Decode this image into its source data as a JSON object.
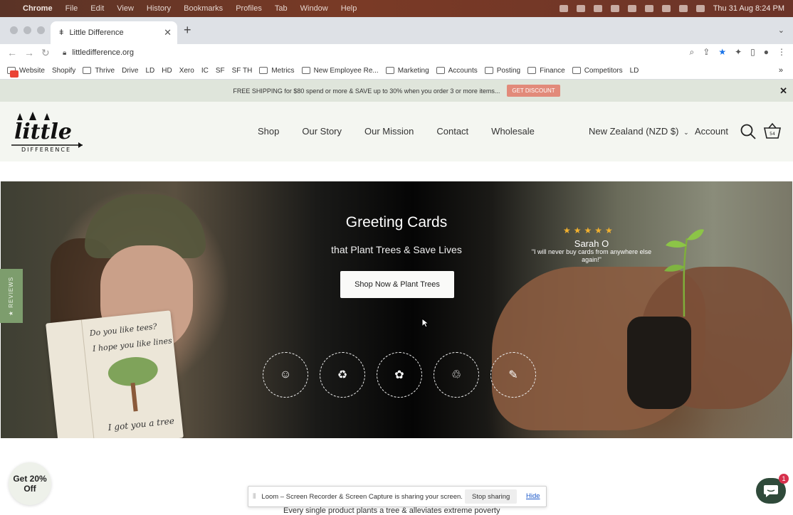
{
  "menubar": {
    "app": "Chrome",
    "items": [
      "File",
      "Edit",
      "View",
      "History",
      "Bookmarks",
      "Profiles",
      "Tab",
      "Window",
      "Help"
    ],
    "clock": "Thu 31 Aug  8:24 PM"
  },
  "browser": {
    "tab_title": "Little Difference",
    "url": "littledifference.org",
    "bookmarks": [
      "Website",
      "Shopify",
      "Thrive",
      "Drive",
      "LD",
      "HD",
      "Xero",
      "IC",
      "SF",
      "SF TH",
      "Metrics",
      "New Employee Re...",
      "Marketing",
      "Accounts",
      "Posting",
      "Finance",
      "Competitors",
      "LD"
    ],
    "more": "»"
  },
  "promo": {
    "text": "FREE SHIPPING for $80 spend or more & SAVE up to 30% when you order 3 or more items...",
    "button": "GET DISCOUNT",
    "close": "✕"
  },
  "header": {
    "logo_top": "little",
    "logo_bottom": "DIFFERENCE",
    "nav": [
      "Shop",
      "Our Story",
      "Our Mission",
      "Contact",
      "Wholesale"
    ],
    "region": "New Zealand (NZD $)",
    "account": "Account",
    "cart_count": "54"
  },
  "hero": {
    "title": "Greeting Cards",
    "subtitle": "that Plant Trees & Save Lives",
    "cta": "Shop Now & Plant Trees",
    "stars": "★★★★★",
    "reviewer": "Sarah O",
    "quote": "\"I will never buy cards from anywhere else again!\"",
    "card_line1": "Do you like tees?",
    "card_line2": "I hope you like lines",
    "card_line3": "I got you a tree"
  },
  "reviews_tab": "★ REVIEWS",
  "discount": "Get 20% Off",
  "loom": {
    "message": "Loom – Screen Recorder & Screen Capture is sharing your screen.",
    "stop": "Stop sharing",
    "hide": "Hide"
  },
  "chat_badge": "1",
  "bottom_text": "Every single product plants a tree & alleviates extreme poverty"
}
